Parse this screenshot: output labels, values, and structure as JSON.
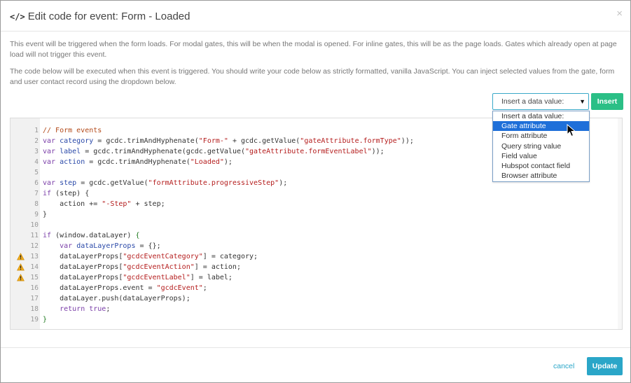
{
  "modal": {
    "title_icon": "</>",
    "title": "Edit code for event: Form - Loaded",
    "close": "×"
  },
  "description": [
    "This event will be triggered when the form loads. For modal gates, this will be when the modal is opened. For inline gates, this will be as the page loads. Gates which already open at page load will not trigger this event.",
    "The code below will be executed when this event is triggered. You should write your code below as strictly formatted, vanilla JavaScript. You can inject selected values from the gate, form and user contact record using the dropdown below."
  ],
  "insert": {
    "select_value": "Insert a data value:",
    "arrow": "▼",
    "button_label": "Insert",
    "options": [
      "Insert a data value:",
      "Gate attribute",
      "Form attribute",
      "Query string value",
      "Field value",
      "Hubspot contact field",
      "Browser attribute"
    ],
    "highlighted_option": "Gate attribute"
  },
  "editor": {
    "lines": [
      {
        "n": "1",
        "warn": false,
        "tokens": [
          [
            "cm",
            "// Form events"
          ]
        ]
      },
      {
        "n": "2",
        "warn": false,
        "tokens": [
          [
            "kw",
            "var"
          ],
          [
            "",
            " "
          ],
          [
            "vr",
            "category"
          ],
          [
            "",
            " = gcdc.trimAndHyphenate("
          ],
          [
            "st",
            "\"Form-\""
          ],
          [
            "",
            " + gcdc.getValue("
          ],
          [
            "st",
            "\"gateAttribute.formType\""
          ],
          [
            "",
            "));"
          ]
        ]
      },
      {
        "n": "3",
        "warn": false,
        "tokens": [
          [
            "kw",
            "var"
          ],
          [
            "",
            " "
          ],
          [
            "vr",
            "label"
          ],
          [
            "",
            " = gcdc.trimAndHyphenate(gcdc.getValue("
          ],
          [
            "st",
            "\"gateAttribute.formEventLabel\""
          ],
          [
            "",
            "));"
          ]
        ]
      },
      {
        "n": "4",
        "warn": false,
        "tokens": [
          [
            "kw",
            "var"
          ],
          [
            "",
            " "
          ],
          [
            "vr",
            "action"
          ],
          [
            "",
            " = gcdc.trimAndHyphenate("
          ],
          [
            "st",
            "\"Loaded\""
          ],
          [
            "",
            ");"
          ]
        ]
      },
      {
        "n": "5",
        "warn": false,
        "tokens": []
      },
      {
        "n": "6",
        "warn": false,
        "tokens": [
          [
            "kw",
            "var"
          ],
          [
            "",
            " "
          ],
          [
            "vr",
            "step"
          ],
          [
            "",
            " = gcdc.getValue("
          ],
          [
            "st",
            "\"formAttribute.progressiveStep\""
          ],
          [
            "",
            ");"
          ]
        ]
      },
      {
        "n": "7",
        "warn": false,
        "tokens": [
          [
            "kw",
            "if"
          ],
          [
            "",
            " (step) {"
          ]
        ]
      },
      {
        "n": "8",
        "warn": false,
        "tokens": [
          [
            "",
            "    action += "
          ],
          [
            "st",
            "\"-Step\""
          ],
          [
            "",
            " + step;"
          ]
        ]
      },
      {
        "n": "9",
        "warn": false,
        "tokens": [
          [
            "",
            "}"
          ]
        ]
      },
      {
        "n": "10",
        "warn": false,
        "tokens": []
      },
      {
        "n": "11",
        "warn": false,
        "tokens": [
          [
            "kw",
            "if"
          ],
          [
            "",
            " (window.dataLayer) "
          ],
          [
            "at",
            "{"
          ]
        ]
      },
      {
        "n": "12",
        "warn": false,
        "tokens": [
          [
            "",
            "    "
          ],
          [
            "kw",
            "var"
          ],
          [
            "",
            " "
          ],
          [
            "vr",
            "dataLayerProps"
          ],
          [
            "",
            " = {};"
          ]
        ]
      },
      {
        "n": "13",
        "warn": true,
        "tokens": [
          [
            "",
            "    dataLayerProps["
          ],
          [
            "st",
            "\"gcdcEventCategory\""
          ],
          [
            "",
            "] = category;"
          ]
        ]
      },
      {
        "n": "14",
        "warn": true,
        "tokens": [
          [
            "",
            "    dataLayerProps["
          ],
          [
            "st",
            "\"gcdcEventAction\""
          ],
          [
            "",
            "] = action;"
          ]
        ]
      },
      {
        "n": "15",
        "warn": true,
        "tokens": [
          [
            "",
            "    dataLayerProps["
          ],
          [
            "st",
            "\"gcdcEventLabel\""
          ],
          [
            "",
            "] = label;"
          ]
        ]
      },
      {
        "n": "16",
        "warn": false,
        "tokens": [
          [
            "",
            "    dataLayerProps.event = "
          ],
          [
            "st",
            "\"gcdcEvent\""
          ],
          [
            "",
            ";"
          ]
        ]
      },
      {
        "n": "17",
        "warn": false,
        "tokens": [
          [
            "",
            "    dataLayer.push(dataLayerProps);"
          ]
        ]
      },
      {
        "n": "18",
        "warn": false,
        "tokens": [
          [
            "",
            "    "
          ],
          [
            "kw",
            "return"
          ],
          [
            "",
            " "
          ],
          [
            "kw",
            "true"
          ],
          [
            "",
            ";"
          ]
        ]
      },
      {
        "n": "19",
        "warn": false,
        "tokens": [
          [
            "at",
            "}"
          ]
        ]
      }
    ]
  },
  "footer": {
    "cancel_label": "cancel",
    "update_label": "Update"
  },
  "colors": {
    "accent": "#2aa6c8",
    "insert_button": "#2bbf86",
    "dropdown_highlight": "#1e6fd9",
    "warning": "#f0ad1e"
  },
  "icons": {
    "title": "code-icon",
    "close": "close-icon",
    "select_arrow": "caret-down-icon",
    "line_warning": "warning-icon",
    "pointer": "mouse-pointer-icon"
  }
}
